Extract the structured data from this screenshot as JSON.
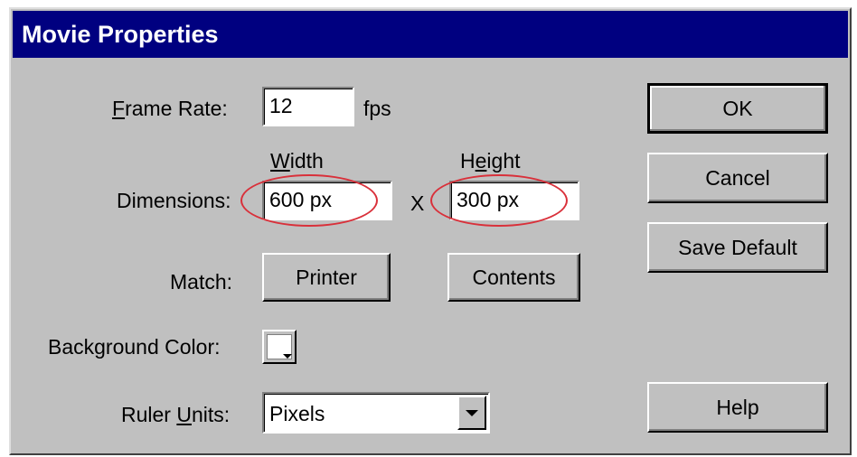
{
  "window": {
    "title": "Movie Properties"
  },
  "frame_rate": {
    "label_key": "F",
    "label_rest": "rame Rate:",
    "value": "12",
    "unit": "fps"
  },
  "dimensions": {
    "label": "Dimensions:",
    "width_label_key": "W",
    "width_label_rest": "idth",
    "height_label_pre": "H",
    "height_label_key": "e",
    "height_label_rest": "ight",
    "width_value": "600 px",
    "separator": "X",
    "height_value": "300 px"
  },
  "match": {
    "label": "Match:",
    "printer_key": "P",
    "printer_rest": "rinter",
    "contents_key": "C",
    "contents_rest": "ontents"
  },
  "background": {
    "label": "Background Color:",
    "color": "#ffffff"
  },
  "ruler": {
    "label_pre": "Ruler ",
    "label_key": "U",
    "label_rest": "nits:",
    "value": "Pixels"
  },
  "buttons": {
    "ok": "OK",
    "cancel": "Cancel",
    "save_default": "Save Default",
    "help_key": "H",
    "help_rest": "elp"
  },
  "colors": {
    "titlebar": "#000080",
    "face": "#c0c0c0",
    "annotation": "#d9303a"
  }
}
